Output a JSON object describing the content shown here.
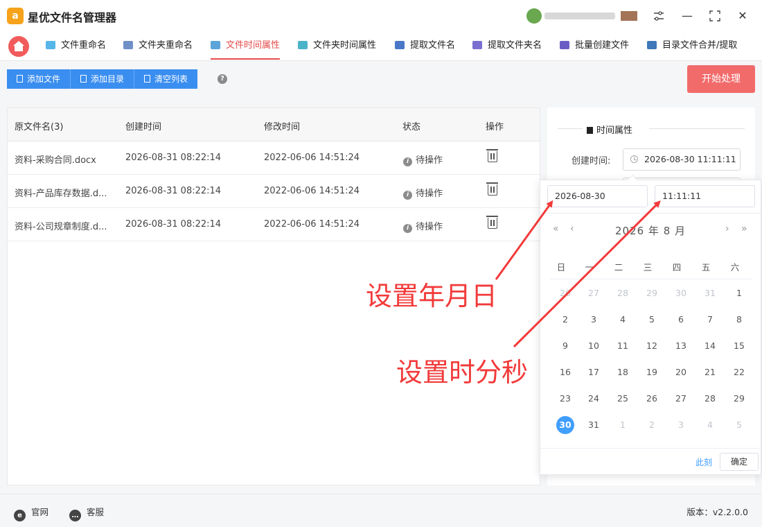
{
  "app": {
    "title": "星优文件名管理器",
    "logo_letter": "a"
  },
  "window_controls": {
    "settings_icon": "sliders-icon",
    "minimize": "—",
    "maximize": "⛶",
    "close": "✕"
  },
  "tabs": [
    {
      "label": "文件重命名",
      "icon_color": "#56b6e8",
      "active": false
    },
    {
      "label": "文件夹重命名",
      "icon_color": "#6f8fc7",
      "active": false
    },
    {
      "label": "文件时间属性",
      "icon_color": "#5aa4d8",
      "active": true
    },
    {
      "label": "文件夹时间属性",
      "icon_color": "#4bb3c8",
      "active": false
    },
    {
      "label": "提取文件名",
      "icon_color": "#4a78c9",
      "active": false
    },
    {
      "label": "提取文件夹名",
      "icon_color": "#7a6fd0",
      "active": false
    },
    {
      "label": "批量创建文件",
      "icon_color": "#6a5ec4",
      "active": false
    },
    {
      "label": "目录文件合并/提取",
      "icon_color": "#3f77b8",
      "active": false
    }
  ],
  "toolbar": {
    "add_file": "添加文件",
    "add_dir": "添加目录",
    "clear_list": "清空列表",
    "help": "?",
    "start": "开始处理"
  },
  "table": {
    "headers": [
      "原文件名(3)",
      "创建时间",
      "修改时间",
      "状态",
      "操作"
    ],
    "rows": [
      {
        "name": "资料-采购合同.docx",
        "created": "2026-08-31 08:22:14",
        "modified": "2022-06-06 14:51:24",
        "status": "待操作"
      },
      {
        "name": "资料-产品库存数据.d...",
        "created": "2026-08-31 08:22:14",
        "modified": "2022-06-06 14:51:24",
        "status": "待操作"
      },
      {
        "name": "资料-公司规章制度.d...",
        "created": "2026-08-31 08:22:14",
        "modified": "2022-06-06 14:51:24",
        "status": "待操作"
      }
    ]
  },
  "right_panel": {
    "section_title": "时间属性",
    "created_label": "创建时间:",
    "created_value": "2026-08-30 11:11:11"
  },
  "picker": {
    "date_value": "2026-08-30",
    "time_value": "11:11:11",
    "month_label": "2026 年  8 月",
    "weekdays": [
      "日",
      "一",
      "二",
      "三",
      "四",
      "五",
      "六"
    ],
    "weeks": [
      [
        [
          "26",
          true
        ],
        [
          "27",
          true
        ],
        [
          "28",
          true
        ],
        [
          "29",
          true
        ],
        [
          "30",
          true
        ],
        [
          "31",
          true
        ],
        [
          "1",
          false
        ]
      ],
      [
        [
          "2",
          false
        ],
        [
          "3",
          false
        ],
        [
          "4",
          false
        ],
        [
          "5",
          false
        ],
        [
          "6",
          false
        ],
        [
          "7",
          false
        ],
        [
          "8",
          false
        ]
      ],
      [
        [
          "9",
          false
        ],
        [
          "10",
          false
        ],
        [
          "11",
          false
        ],
        [
          "12",
          false
        ],
        [
          "13",
          false
        ],
        [
          "14",
          false
        ],
        [
          "15",
          false
        ]
      ],
      [
        [
          "16",
          false
        ],
        [
          "17",
          false
        ],
        [
          "18",
          false
        ],
        [
          "19",
          false
        ],
        [
          "20",
          false
        ],
        [
          "21",
          false
        ],
        [
          "22",
          false
        ]
      ],
      [
        [
          "23",
          false
        ],
        [
          "24",
          false
        ],
        [
          "25",
          false
        ],
        [
          "26",
          false
        ],
        [
          "27",
          false
        ],
        [
          "28",
          false
        ],
        [
          "29",
          false
        ]
      ],
      [
        [
          "30",
          false
        ],
        [
          "31",
          false
        ],
        [
          "1",
          true
        ],
        [
          "2",
          true
        ],
        [
          "3",
          true
        ],
        [
          "4",
          true
        ],
        [
          "5",
          true
        ]
      ]
    ],
    "selected_day": "30",
    "now_label": "此刻",
    "ok_label": "确定"
  },
  "annotations": {
    "date_hint": "设置年月日",
    "time_hint": "设置时分秒",
    "color": "#f23a3a"
  },
  "footer": {
    "website": "官网",
    "support": "客服",
    "version": "版本：v2.2.0.0"
  }
}
